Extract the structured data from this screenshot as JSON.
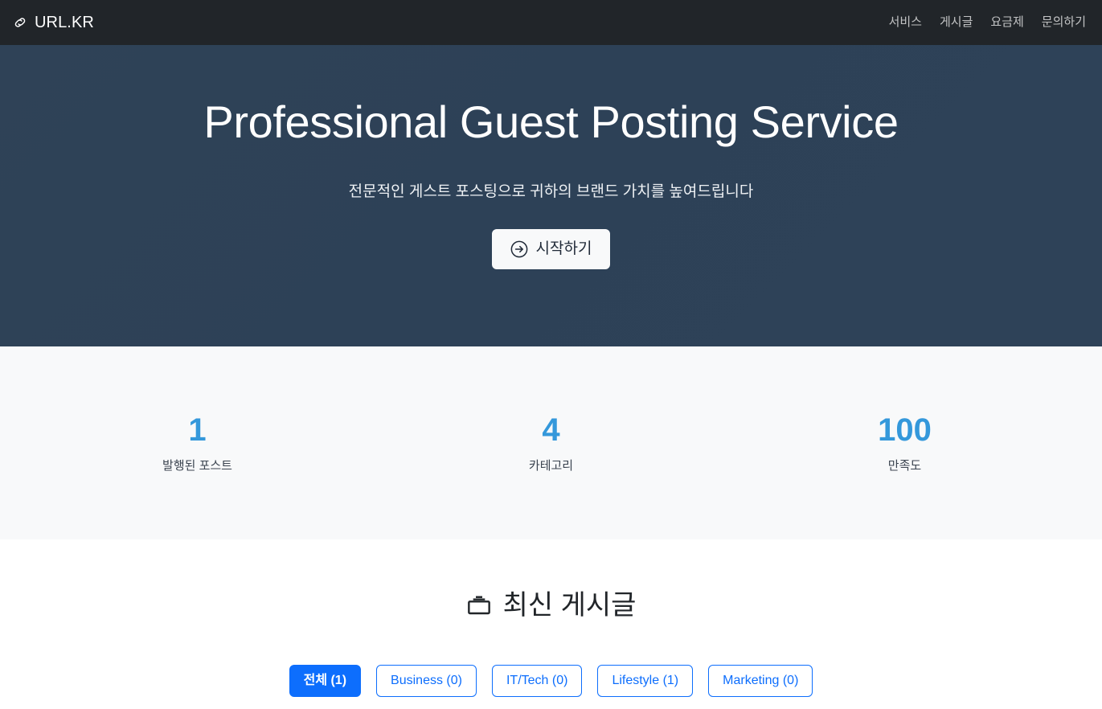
{
  "navbar": {
    "brand": {
      "label": "URL.KR",
      "icon": "link-icon"
    },
    "links": [
      {
        "label": "서비스"
      },
      {
        "label": "게시글"
      },
      {
        "label": "요금제"
      },
      {
        "label": "문의하기"
      }
    ]
  },
  "hero": {
    "title": "Professional Guest Posting Service",
    "subtitle": "전문적인 게스트 포스팅으로 귀하의 브랜드 가치를 높여드립니다",
    "cta": {
      "label": "시작하기",
      "icon": "arrow-right-circle-icon"
    },
    "background_color": "#2e4257",
    "text_color": "#ffffff"
  },
  "stats": {
    "background_color": "#f8f9fa",
    "value_color": "#3498db",
    "items": [
      {
        "value": "1",
        "label": "발행된 포스트"
      },
      {
        "value": "4",
        "label": "카테고리"
      },
      {
        "value": "100",
        "label": "만족도"
      }
    ]
  },
  "posts": {
    "heading": "최신 게시글",
    "heading_icon": "briefcase-icon",
    "filters": [
      {
        "label": "전체 (1)",
        "active": true
      },
      {
        "label": "Business (0)",
        "active": false
      },
      {
        "label": "IT/Tech (0)",
        "active": false
      },
      {
        "label": "Lifestyle (1)",
        "active": false
      },
      {
        "label": "Marketing (0)",
        "active": false
      }
    ],
    "accent_color": "#0d6efd"
  }
}
